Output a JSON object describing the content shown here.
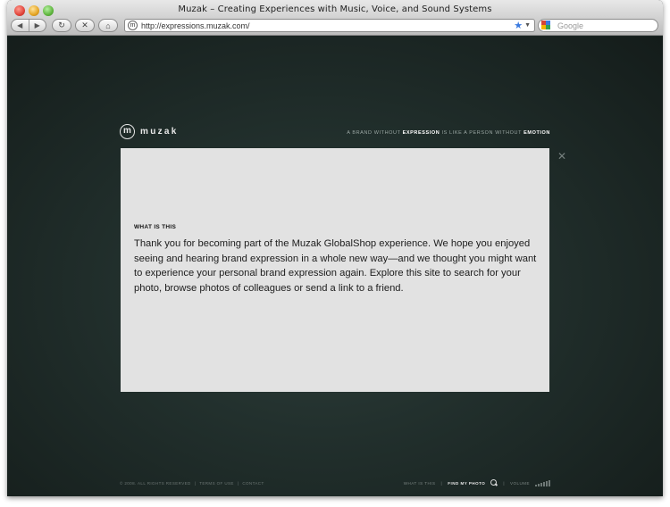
{
  "browser": {
    "title": "Muzak – Creating Experiences with Music, Voice, and Sound Systems",
    "url": "http://expressions.muzak.com/",
    "search_placeholder": "Google",
    "nav_back": "◀",
    "nav_forward": "▶",
    "reload": "↻",
    "stop": "✕",
    "home": "⌂",
    "bookmark": "★",
    "url_dropdown": "▼"
  },
  "header": {
    "logo_mark": "m",
    "logo_text": "muzak",
    "tagline": {
      "part1": "A BRAND WITHOUT ",
      "bold1": "EXPRESSION",
      "part2": " IS LIKE A PERSON WITHOUT ",
      "bold2": "EMOTION"
    }
  },
  "panel": {
    "close": "✕",
    "heading": "WHAT IS THIS",
    "body": "Thank you for becoming part of the Muzak GlobalShop experience. We hope you enjoyed seeing and hearing brand expression in a whole new way—and we thought you might want to experience your personal brand expression again. Explore this site to search for your photo, browse photos of colleagues or send a link to a friend."
  },
  "footer": {
    "copyright": "© 2008. ALL RIGHTS RESERVED",
    "divider": "|",
    "terms": "TERMS OF USE",
    "contact": "CONTACT",
    "what_is_this": "WHAT IS THIS",
    "find_my_photo": "FIND MY PHOTO",
    "volume": "VOLUME"
  },
  "colors": {
    "page_bg": "#22302d",
    "panel_bg": "#e2e2e2",
    "text_light": "#e8e8e8"
  }
}
